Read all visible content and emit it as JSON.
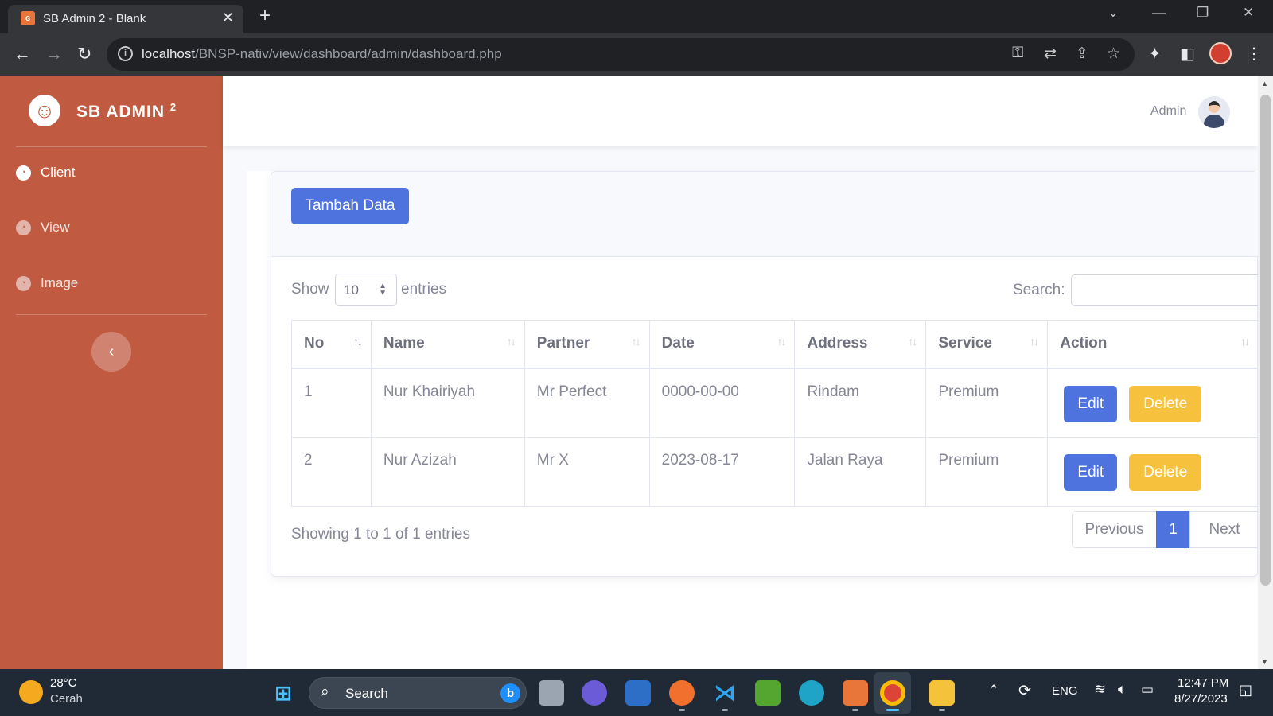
{
  "browser": {
    "tab_title": "SB Admin 2 - Blank",
    "favicon_text": "ɞ",
    "url_host": "localhost",
    "url_path": "/BNSP-nativ/view/dashboard/admin/dashboard.php"
  },
  "sidebar": {
    "brand": "SB ADMIN",
    "brand_sup": "2",
    "items": [
      {
        "label": "Client",
        "icon": "tachometer-icon"
      },
      {
        "label": "View",
        "icon": "tachometer-icon"
      },
      {
        "label": "Image",
        "icon": "tachometer-icon"
      }
    ],
    "toggle_icon": "chevron-left-icon"
  },
  "topbar": {
    "user_name": "Admin"
  },
  "card": {
    "add_button": "Tambah Data",
    "show_label": "Show",
    "page_length": "10",
    "entries_label": "entries",
    "search_label": "Search:",
    "search_value": "",
    "columns": [
      "No",
      "Name",
      "Partner",
      "Date",
      "Address",
      "Service",
      "Action"
    ],
    "rows": [
      {
        "no": "1",
        "name": "Nur Khairiyah",
        "partner": "Mr Perfect",
        "date": "0000-00-00",
        "address": "Rindam",
        "service": "Premium"
      },
      {
        "no": "2",
        "name": "Nur Azizah",
        "partner": "Mr X",
        "date": "2023-08-17",
        "address": "Jalan Raya",
        "service": "Premium"
      }
    ],
    "edit_label": "Edit",
    "delete_label": "Delete",
    "info": "Showing 1 to 1 of 1 entries",
    "pagination": {
      "previous": "Previous",
      "current": "1",
      "next": "Next"
    }
  },
  "taskbar": {
    "weather_temp": "28°C",
    "weather_desc": "Cerah",
    "search_label": "Search",
    "lang": "ENG",
    "time": "12:47 PM",
    "date": "8/27/2023"
  },
  "colors": {
    "sidebar": "#c05a40",
    "primary": "#4e73df",
    "warning": "#f6c23e"
  }
}
